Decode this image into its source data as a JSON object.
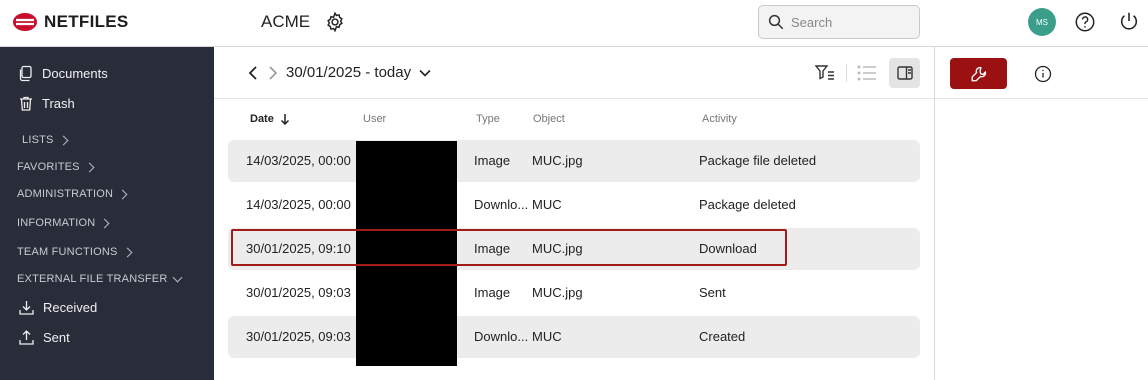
{
  "brand": {
    "name": "NETFILES",
    "accent": "#c8102e"
  },
  "header": {
    "title": "ACME",
    "search_placeholder": "Search",
    "avatar_initials": "MS",
    "avatar_color": "#3a9e8a"
  },
  "sidebar": {
    "items": [
      {
        "label": "Documents",
        "icon": "document-icon"
      },
      {
        "label": "Trash",
        "icon": "trash-icon"
      }
    ],
    "sections": [
      {
        "label": "LISTS",
        "expanded": false
      },
      {
        "label": "FAVORITES",
        "expanded": false
      },
      {
        "label": "ADMINISTRATION",
        "expanded": false
      },
      {
        "label": "INFORMATION",
        "expanded": false
      },
      {
        "label": "TEAM FUNCTIONS",
        "expanded": false
      },
      {
        "label": "EXTERNAL FILE TRANSFER",
        "expanded": true
      }
    ],
    "transfer_items": [
      {
        "label": "Received",
        "icon": "download-icon"
      },
      {
        "label": "Sent",
        "icon": "upload-icon"
      }
    ]
  },
  "toolbar": {
    "date_range": "30/01/2025 - today"
  },
  "table": {
    "columns": {
      "date": "Date",
      "user": "User",
      "type": "Type",
      "object": "Object",
      "activity": "Activity"
    },
    "rows": [
      {
        "date": "14/03/2025, 00:00",
        "type": "Image",
        "object": "MUC.jpg",
        "activity": "Package file deleted"
      },
      {
        "date": "14/03/2025, 00:00",
        "type": "Downlo...",
        "object": "MUC",
        "activity": "Package deleted"
      },
      {
        "date": "30/01/2025, 09:10",
        "type": "Image",
        "object": "MUC.jpg",
        "activity": "Download"
      },
      {
        "date": "30/01/2025, 09:03",
        "type": "Image",
        "object": "MUC.jpg",
        "activity": "Sent"
      },
      {
        "date": "30/01/2025, 09:03",
        "type": "Downlo...",
        "object": "MUC",
        "activity": "Created"
      }
    ]
  },
  "right_panel": {
    "tools_button_color": "#9b1111"
  }
}
